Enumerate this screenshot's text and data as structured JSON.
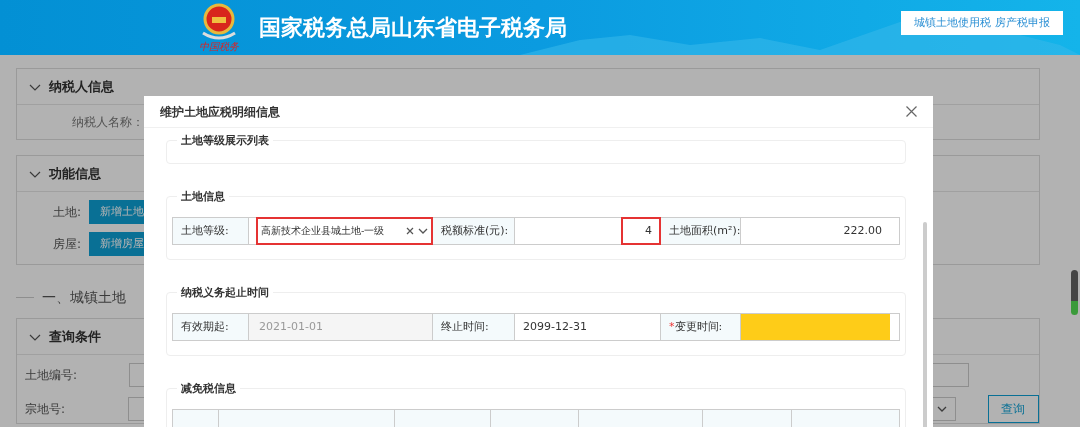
{
  "header": {
    "emblem_caption": "中国税务",
    "title": "国家税务总局山东省电子税务局",
    "nav_button": "城镇土地使用税 房产税申报"
  },
  "page": {
    "taxpayer_section": {
      "title": "纳税人信息",
      "expanded": true,
      "name_label": "纳税人名称："
    },
    "function_section": {
      "title": "功能信息",
      "expanded": true,
      "rows": [
        {
          "label": "土地:",
          "button": "新增土地"
        },
        {
          "label": "房屋:",
          "button": "新增房屋"
        }
      ]
    },
    "heading": "一、城镇土地",
    "query_section": {
      "title": "查询条件",
      "expanded": true,
      "fields": [
        {
          "label": "土地编号:"
        },
        {
          "label": "宗地号:"
        }
      ],
      "button": "查询"
    }
  },
  "dialog": {
    "title": "维护土地应税明细信息",
    "sections": [
      {
        "kind": "empty",
        "title": "土地等级展示列表"
      },
      {
        "kind": "row",
        "title": "土地信息",
        "cells": [
          {
            "kind": "label",
            "text": "土地等级:"
          },
          {
            "kind": "select",
            "value": "高新技术企业县城土地-一级",
            "highlighted": true
          },
          {
            "kind": "label",
            "text": "税额标准(元):"
          },
          {
            "kind": "input",
            "value": "4",
            "disabled": false,
            "highlighted": true,
            "marked": false
          },
          {
            "kind": "label",
            "text": "土地面积(m²):"
          },
          {
            "kind": "input",
            "value": "222.00",
            "disabled": false,
            "highlighted": false,
            "marked": false
          }
        ]
      },
      {
        "kind": "row",
        "title": "纳税义务起止时间",
        "cells": [
          {
            "kind": "label",
            "text": "有效期起:"
          },
          {
            "kind": "input",
            "value": "2021-01-01",
            "disabled": true,
            "highlighted": false,
            "marked": false
          },
          {
            "kind": "label",
            "text": "终止时间:"
          },
          {
            "kind": "input",
            "value": "2099-12-31",
            "disabled": false,
            "highlighted": false,
            "marked": false
          },
          {
            "kind": "label",
            "text": "变更时间:",
            "required_mark": "*"
          },
          {
            "kind": "input",
            "disabled": false,
            "highlighted": false,
            "marked": true
          }
        ]
      },
      {
        "kind": "table",
        "title": "减免税信息"
      }
    ]
  }
}
